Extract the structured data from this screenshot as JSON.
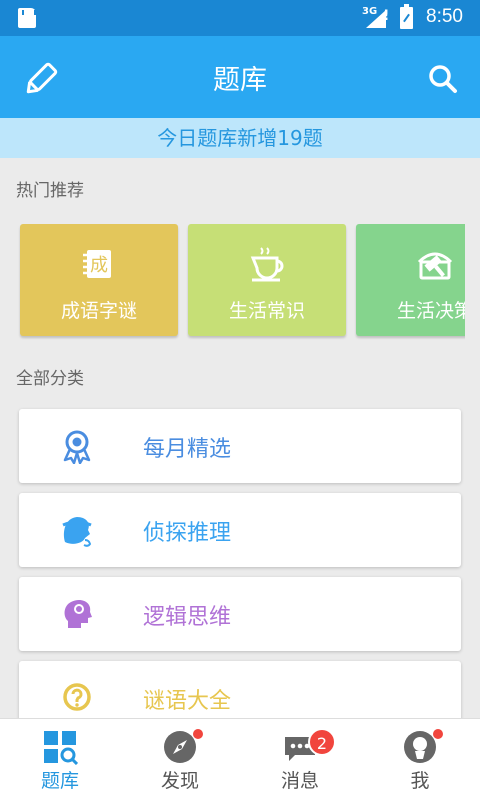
{
  "status_bar": {
    "network": "3G",
    "signal_alert": "!",
    "time": "8:50"
  },
  "app_bar": {
    "title": "题库",
    "left_icon": "pencil-icon",
    "right_icon": "search-icon"
  },
  "notice": "今日题库新增19题",
  "hot": {
    "label": "热门推荐",
    "items": [
      {
        "label": "成语字谜",
        "icon": "idiom-book-icon",
        "icon_text": "成",
        "color": "#e3c65b"
      },
      {
        "label": "生活常识",
        "icon": "teacup-icon",
        "color": "#c6df76"
      },
      {
        "label": "生活决策",
        "icon": "gavel-icon",
        "color": "#85d48d"
      }
    ]
  },
  "categories": {
    "label": "全部分类",
    "items": [
      {
        "label": "每月精选",
        "icon": "award-ribbon-icon",
        "color": "#4a8de0"
      },
      {
        "label": "侦探推理",
        "icon": "detective-icon",
        "color": "#3aa3f0"
      },
      {
        "label": "逻辑思维",
        "icon": "brain-head-icon",
        "color": "#b072d6"
      },
      {
        "label": "谜语大全",
        "icon": "question-circle-icon",
        "color": "#e7c64f"
      }
    ]
  },
  "tabs": [
    {
      "label": "题库",
      "icon": "grid-search-icon",
      "active": true
    },
    {
      "label": "发现",
      "icon": "compass-icon",
      "dot": true
    },
    {
      "label": "消息",
      "icon": "chat-bubble-icon",
      "badge": "2"
    },
    {
      "label": "我",
      "icon": "user-avatar-icon",
      "dot": true
    }
  ],
  "colors": {
    "status_bar": "#1a87d3",
    "app_bar": "#2aa8f2",
    "notice_bg": "#bde6fb",
    "accent": "#2597df",
    "badge": "#f1453d"
  }
}
